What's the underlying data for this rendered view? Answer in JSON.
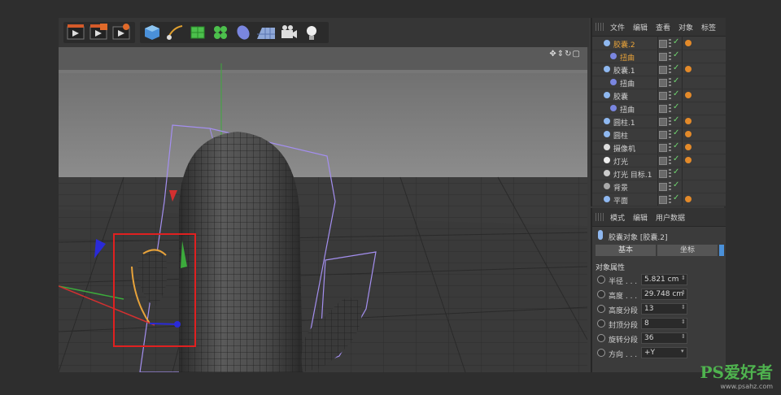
{
  "toolbar": {
    "buttons": [
      "render-view",
      "render-to-picture-viewer",
      "render-settings",
      "cube",
      "pen",
      "subdivision-surface",
      "cloner",
      "deformer",
      "floor",
      "camera",
      "light"
    ]
  },
  "object_manager": {
    "menu": [
      "文件",
      "编辑",
      "查看",
      "对象",
      "标签"
    ],
    "items": [
      {
        "name": "胶囊.2",
        "indent": 1,
        "selected": true,
        "icon": "capsule-icon",
        "tag": true
      },
      {
        "name": "扭曲",
        "indent": 2,
        "selected": true,
        "icon": "bend-icon",
        "tag": false
      },
      {
        "name": "胶囊.1",
        "indent": 1,
        "selected": false,
        "icon": "capsule-icon",
        "tag": true
      },
      {
        "name": "扭曲",
        "indent": 2,
        "selected": false,
        "icon": "bend-icon",
        "tag": false
      },
      {
        "name": "胶囊",
        "indent": 1,
        "selected": false,
        "icon": "capsule-icon",
        "tag": true
      },
      {
        "name": "扭曲",
        "indent": 2,
        "selected": false,
        "icon": "bend-icon",
        "tag": false
      },
      {
        "name": "圆柱.1",
        "indent": 1,
        "selected": false,
        "icon": "cylinder-icon",
        "tag": true
      },
      {
        "name": "圆柱",
        "indent": 1,
        "selected": false,
        "icon": "cylinder-icon",
        "tag": true
      },
      {
        "name": "摄像机",
        "indent": 1,
        "selected": false,
        "icon": "camera-icon",
        "tag": true
      },
      {
        "name": "灯光",
        "indent": 1,
        "selected": false,
        "icon": "light-icon",
        "tag": true
      },
      {
        "name": "灯光 目标.1",
        "indent": 1,
        "selected": false,
        "icon": "target-light-icon",
        "tag": false
      },
      {
        "name": "背景",
        "indent": 1,
        "selected": false,
        "icon": "background-icon",
        "tag": false
      },
      {
        "name": "平面",
        "indent": 1,
        "selected": false,
        "icon": "plane-icon",
        "tag": true
      }
    ]
  },
  "attribute_manager": {
    "menu": [
      "模式",
      "编辑",
      "用户数据"
    ],
    "object_title": "胶囊对象 [胶囊.2]",
    "tabs": [
      "基本",
      "坐标"
    ],
    "section": "对象属性",
    "props": [
      {
        "label": "半径 . . .",
        "value": "5.821 cm"
      },
      {
        "label": "高度 . . .",
        "value": "29.748 cm"
      },
      {
        "label": "高度分段",
        "value": "13"
      },
      {
        "label": "封顶分段",
        "value": "8"
      },
      {
        "label": "旋转分段",
        "value": "36"
      },
      {
        "label": "方向 . . .",
        "value": "+Y"
      }
    ]
  },
  "watermark": {
    "text": "PS爱好者",
    "url": "www.psahz.com"
  },
  "colors": {
    "selected": "#e8a33a",
    "accent": "#4a90d9",
    "check": "#6fd36f"
  }
}
